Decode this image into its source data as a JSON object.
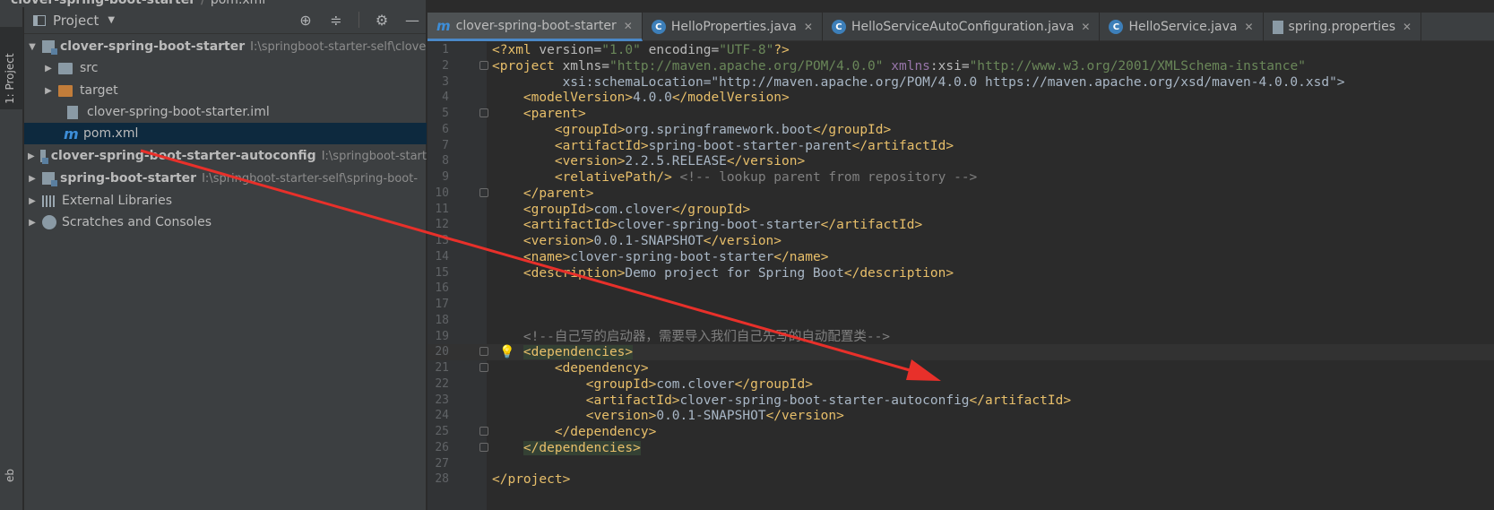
{
  "breadcrumb": [
    "clover-spring-boot-starter",
    "pom.xml"
  ],
  "left_stripe": {
    "project_tab": "1: Project",
    "bottom_label": "eb"
  },
  "project_panel": {
    "title": "Project",
    "tree": [
      {
        "label": "clover-spring-boot-starter",
        "path": "I:\\springboot-starter-self\\clove",
        "kind": "module",
        "expanded": true
      },
      {
        "label": "src",
        "kind": "folder"
      },
      {
        "label": "target",
        "kind": "folder-orange"
      },
      {
        "label": "clover-spring-boot-starter.iml",
        "kind": "iml"
      },
      {
        "label": "pom.xml",
        "kind": "maven",
        "selected": true
      },
      {
        "label": "clover-spring-boot-starter-autoconfig",
        "path": "I:\\springboot-start",
        "kind": "module"
      },
      {
        "label": "spring-boot-starter",
        "path": "I:\\springboot-starter-self\\spring-boot-",
        "kind": "module"
      },
      {
        "label": "External Libraries",
        "kind": "library"
      },
      {
        "label": "Scratches and Consoles",
        "kind": "scratch"
      }
    ]
  },
  "tabs": [
    {
      "label": "clover-spring-boot-starter",
      "icon": "maven-icon",
      "active": true
    },
    {
      "label": "HelloProperties.java",
      "icon": "class-icon"
    },
    {
      "label": "HelloServiceAutoConfiguration.java",
      "icon": "class-icon"
    },
    {
      "label": "HelloService.java",
      "icon": "class-icon"
    },
    {
      "label": "spring.properties",
      "icon": "properties-icon"
    }
  ],
  "colors": {
    "accent": "#4a88c7",
    "arrow": "#e8302a",
    "tag": "#e8bf6a",
    "value": "#6a8759"
  },
  "editor": {
    "lines": [
      "<?xml version=\"1.0\" encoding=\"UTF-8\"?>",
      "<project xmlns=\"http://maven.apache.org/POM/4.0.0\" xmlns:xsi=\"http://www.w3.org/2001/XMLSchema-instance\"",
      "         xsi:schemaLocation=\"http://maven.apache.org/POM/4.0.0 https://maven.apache.org/xsd/maven-4.0.0.xsd\">",
      "    <modelVersion>4.0.0</modelVersion>",
      "    <parent>",
      "        <groupId>org.springframework.boot</groupId>",
      "        <artifactId>spring-boot-starter-parent</artifactId>",
      "        <version>2.2.5.RELEASE</version>",
      "        <relativePath/> <!-- lookup parent from repository -->",
      "    </parent>",
      "    <groupId>com.clover</groupId>",
      "    <artifactId>clover-spring-boot-starter</artifactId>",
      "    <version>0.0.1-SNAPSHOT</version>",
      "    <name>clover-spring-boot-starter</name>",
      "    <description>Demo project for Spring Boot</description>",
      "",
      "",
      "",
      "    <!--自己写的启动器，需要导入我们自己先写的自动配置类-->",
      "    <dependencies>",
      "        <dependency>",
      "            <groupId>com.clover</groupId>",
      "            <artifactId>clover-spring-boot-starter-autoconfig</artifactId>",
      "            <version>0.0.1-SNAPSHOT</version>",
      "        </dependency>",
      "    </dependencies>",
      "",
      "</project>"
    ]
  }
}
